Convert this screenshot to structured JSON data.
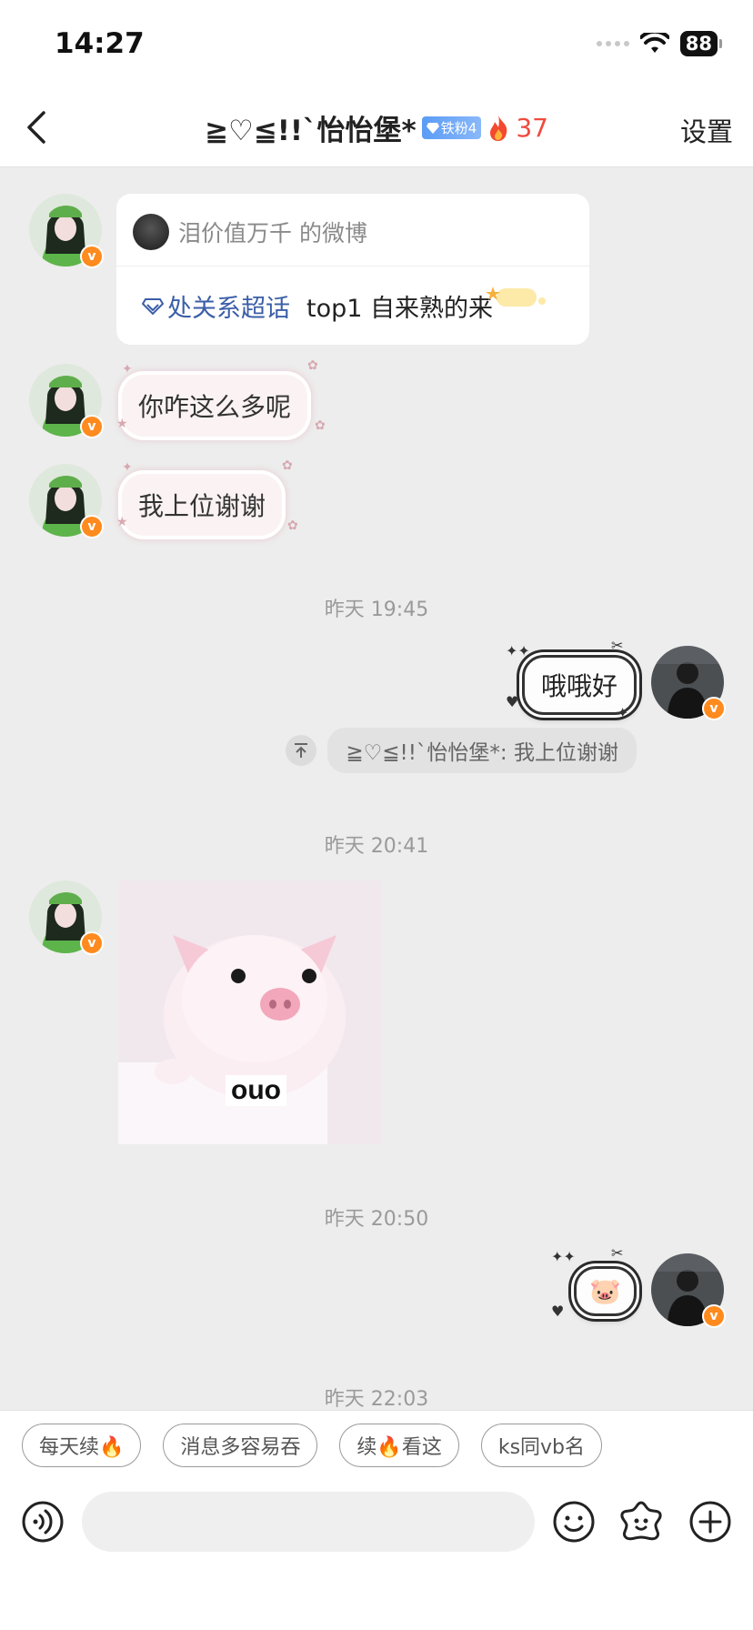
{
  "status_bar": {
    "time": "14:27",
    "battery": "88"
  },
  "nav": {
    "title": "≧♡≦!!`怡怡堡*",
    "fan_badge": "铁粉4",
    "fire_count": "37",
    "settings": "设置"
  },
  "messages": {
    "share_card": {
      "author": "泪价值万千 的微博",
      "topic": "处关系超话",
      "text": "top1 自来熟的来"
    },
    "msg1": "你咋这么多呢",
    "msg2": "我上位谢谢",
    "time1": "昨天 19:45",
    "my_msg1": "哦哦好",
    "quote": "≧♡≦!!`怡怡堡*: 我上位谢谢",
    "time2": "昨天 20:41",
    "image_caption": "ouo",
    "time3": "昨天 20:50",
    "my_msg2": "🐷",
    "time4": "昨天 22:03"
  },
  "quick_replies": [
    "每天续🔥",
    "消息多容易吞",
    "续🔥看这",
    "ks同vb名"
  ],
  "icons": {
    "back": "chevron-left-icon",
    "voice": "voice-icon",
    "emoji": "smiley-icon",
    "sticker": "sticker-icon",
    "plus": "plus-icon"
  },
  "colors": {
    "accent_fire": "#f04a3f",
    "topic_blue": "#3b5ea8",
    "vip_orange": "#ff8a1e"
  }
}
